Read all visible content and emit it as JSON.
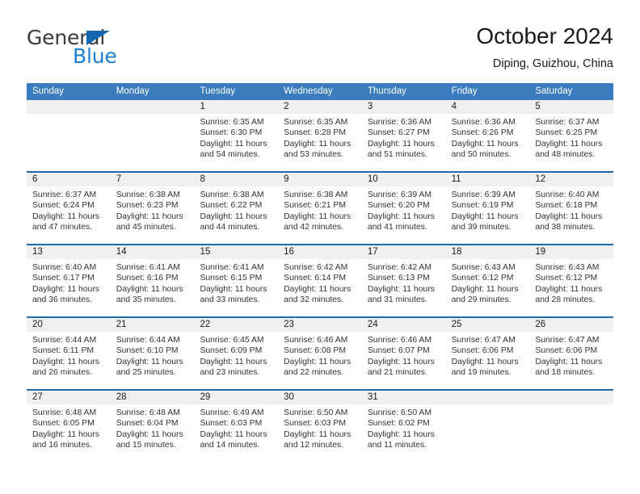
{
  "logo": {
    "word_top": "General",
    "word_bottom": "Blue",
    "triangle_icon": "triangle-icon",
    "color_dark": "#3a3a3a",
    "color_blue": "#1a7fd4"
  },
  "header": {
    "title": "October 2024",
    "subtitle": "Diping, Guizhou, China"
  },
  "colors": {
    "header_blue": "#3a7cbe",
    "row_border_blue": "#1e6bb0",
    "day_band_gray": "#f0f0f0"
  },
  "weekdays": [
    "Sunday",
    "Monday",
    "Tuesday",
    "Wednesday",
    "Thursday",
    "Friday",
    "Saturday"
  ],
  "weeks": [
    [
      {
        "day": "",
        "lines": []
      },
      {
        "day": "",
        "lines": []
      },
      {
        "day": "1",
        "lines": [
          "Sunrise: 6:35 AM",
          "Sunset: 6:30 PM",
          "Daylight: 11 hours",
          "and 54 minutes."
        ]
      },
      {
        "day": "2",
        "lines": [
          "Sunrise: 6:35 AM",
          "Sunset: 6:28 PM",
          "Daylight: 11 hours",
          "and 53 minutes."
        ]
      },
      {
        "day": "3",
        "lines": [
          "Sunrise: 6:36 AM",
          "Sunset: 6:27 PM",
          "Daylight: 11 hours",
          "and 51 minutes."
        ]
      },
      {
        "day": "4",
        "lines": [
          "Sunrise: 6:36 AM",
          "Sunset: 6:26 PM",
          "Daylight: 11 hours",
          "and 50 minutes."
        ]
      },
      {
        "day": "5",
        "lines": [
          "Sunrise: 6:37 AM",
          "Sunset: 6:25 PM",
          "Daylight: 11 hours",
          "and 48 minutes."
        ]
      }
    ],
    [
      {
        "day": "6",
        "lines": [
          "Sunrise: 6:37 AM",
          "Sunset: 6:24 PM",
          "Daylight: 11 hours",
          "and 47 minutes."
        ]
      },
      {
        "day": "7",
        "lines": [
          "Sunrise: 6:38 AM",
          "Sunset: 6:23 PM",
          "Daylight: 11 hours",
          "and 45 minutes."
        ]
      },
      {
        "day": "8",
        "lines": [
          "Sunrise: 6:38 AM",
          "Sunset: 6:22 PM",
          "Daylight: 11 hours",
          "and 44 minutes."
        ]
      },
      {
        "day": "9",
        "lines": [
          "Sunrise: 6:38 AM",
          "Sunset: 6:21 PM",
          "Daylight: 11 hours",
          "and 42 minutes."
        ]
      },
      {
        "day": "10",
        "lines": [
          "Sunrise: 6:39 AM",
          "Sunset: 6:20 PM",
          "Daylight: 11 hours",
          "and 41 minutes."
        ]
      },
      {
        "day": "11",
        "lines": [
          "Sunrise: 6:39 AM",
          "Sunset: 6:19 PM",
          "Daylight: 11 hours",
          "and 39 minutes."
        ]
      },
      {
        "day": "12",
        "lines": [
          "Sunrise: 6:40 AM",
          "Sunset: 6:18 PM",
          "Daylight: 11 hours",
          "and 38 minutes."
        ]
      }
    ],
    [
      {
        "day": "13",
        "lines": [
          "Sunrise: 6:40 AM",
          "Sunset: 6:17 PM",
          "Daylight: 11 hours",
          "and 36 minutes."
        ]
      },
      {
        "day": "14",
        "lines": [
          "Sunrise: 6:41 AM",
          "Sunset: 6:16 PM",
          "Daylight: 11 hours",
          "and 35 minutes."
        ]
      },
      {
        "day": "15",
        "lines": [
          "Sunrise: 6:41 AM",
          "Sunset: 6:15 PM",
          "Daylight: 11 hours",
          "and 33 minutes."
        ]
      },
      {
        "day": "16",
        "lines": [
          "Sunrise: 6:42 AM",
          "Sunset: 6:14 PM",
          "Daylight: 11 hours",
          "and 32 minutes."
        ]
      },
      {
        "day": "17",
        "lines": [
          "Sunrise: 6:42 AM",
          "Sunset: 6:13 PM",
          "Daylight: 11 hours",
          "and 31 minutes."
        ]
      },
      {
        "day": "18",
        "lines": [
          "Sunrise: 6:43 AM",
          "Sunset: 6:12 PM",
          "Daylight: 11 hours",
          "and 29 minutes."
        ]
      },
      {
        "day": "19",
        "lines": [
          "Sunrise: 6:43 AM",
          "Sunset: 6:12 PM",
          "Daylight: 11 hours",
          "and 28 minutes."
        ]
      }
    ],
    [
      {
        "day": "20",
        "lines": [
          "Sunrise: 6:44 AM",
          "Sunset: 6:11 PM",
          "Daylight: 11 hours",
          "and 26 minutes."
        ]
      },
      {
        "day": "21",
        "lines": [
          "Sunrise: 6:44 AM",
          "Sunset: 6:10 PM",
          "Daylight: 11 hours",
          "and 25 minutes."
        ]
      },
      {
        "day": "22",
        "lines": [
          "Sunrise: 6:45 AM",
          "Sunset: 6:09 PM",
          "Daylight: 11 hours",
          "and 23 minutes."
        ]
      },
      {
        "day": "23",
        "lines": [
          "Sunrise: 6:46 AM",
          "Sunset: 6:08 PM",
          "Daylight: 11 hours",
          "and 22 minutes."
        ]
      },
      {
        "day": "24",
        "lines": [
          "Sunrise: 6:46 AM",
          "Sunset: 6:07 PM",
          "Daylight: 11 hours",
          "and 21 minutes."
        ]
      },
      {
        "day": "25",
        "lines": [
          "Sunrise: 6:47 AM",
          "Sunset: 6:06 PM",
          "Daylight: 11 hours",
          "and 19 minutes."
        ]
      },
      {
        "day": "26",
        "lines": [
          "Sunrise: 6:47 AM",
          "Sunset: 6:06 PM",
          "Daylight: 11 hours",
          "and 18 minutes."
        ]
      }
    ],
    [
      {
        "day": "27",
        "lines": [
          "Sunrise: 6:48 AM",
          "Sunset: 6:05 PM",
          "Daylight: 11 hours",
          "and 16 minutes."
        ]
      },
      {
        "day": "28",
        "lines": [
          "Sunrise: 6:48 AM",
          "Sunset: 6:04 PM",
          "Daylight: 11 hours",
          "and 15 minutes."
        ]
      },
      {
        "day": "29",
        "lines": [
          "Sunrise: 6:49 AM",
          "Sunset: 6:03 PM",
          "Daylight: 11 hours",
          "and 14 minutes."
        ]
      },
      {
        "day": "30",
        "lines": [
          "Sunrise: 6:50 AM",
          "Sunset: 6:03 PM",
          "Daylight: 11 hours",
          "and 12 minutes."
        ]
      },
      {
        "day": "31",
        "lines": [
          "Sunrise: 6:50 AM",
          "Sunset: 6:02 PM",
          "Daylight: 11 hours",
          "and 11 minutes."
        ]
      },
      {
        "day": "",
        "lines": []
      },
      {
        "day": "",
        "lines": []
      }
    ]
  ]
}
